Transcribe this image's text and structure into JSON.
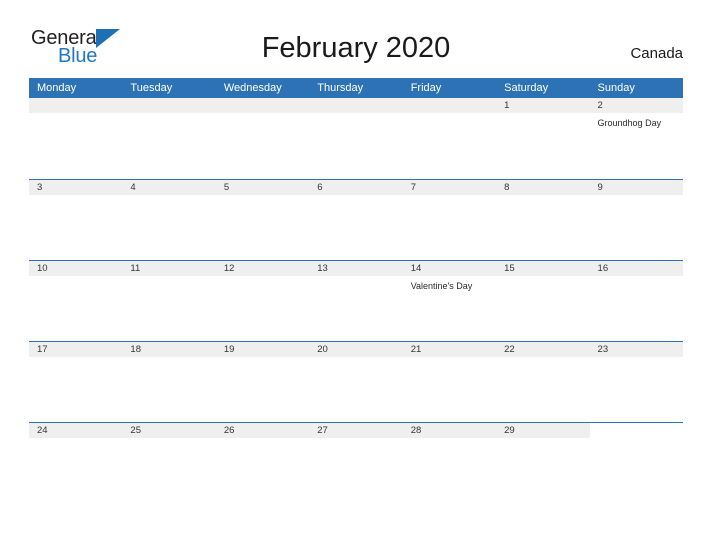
{
  "brand": {
    "word_one": "General",
    "word_two": "Blue",
    "triangle_color": "#1f6fb5",
    "word_two_color": "#1f78c1"
  },
  "header": {
    "title": "February 2020",
    "country": "Canada"
  },
  "theme": {
    "header_blue": "#2d72b5",
    "date_band_gray": "#efefef",
    "page_background": "#ffffff"
  },
  "calendar": {
    "weekday_headers": [
      "Monday",
      "Tuesday",
      "Wednesday",
      "Thursday",
      "Friday",
      "Saturday",
      "Sunday"
    ],
    "weeks": [
      [
        {
          "day": "",
          "event": "",
          "filled": false
        },
        {
          "day": "",
          "event": "",
          "filled": false
        },
        {
          "day": "",
          "event": "",
          "filled": false
        },
        {
          "day": "",
          "event": "",
          "filled": false
        },
        {
          "day": "",
          "event": "",
          "filled": false
        },
        {
          "day": "1",
          "event": "",
          "filled": true
        },
        {
          "day": "2",
          "event": "Groundhog Day",
          "filled": true
        }
      ],
      [
        {
          "day": "3",
          "event": "",
          "filled": true
        },
        {
          "day": "4",
          "event": "",
          "filled": true
        },
        {
          "day": "5",
          "event": "",
          "filled": true
        },
        {
          "day": "6",
          "event": "",
          "filled": true
        },
        {
          "day": "7",
          "event": "",
          "filled": true
        },
        {
          "day": "8",
          "event": "",
          "filled": true
        },
        {
          "day": "9",
          "event": "",
          "filled": true
        }
      ],
      [
        {
          "day": "10",
          "event": "",
          "filled": true
        },
        {
          "day": "11",
          "event": "",
          "filled": true
        },
        {
          "day": "12",
          "event": "",
          "filled": true
        },
        {
          "day": "13",
          "event": "",
          "filled": true
        },
        {
          "day": "14",
          "event": "Valentine's Day",
          "filled": true
        },
        {
          "day": "15",
          "event": "",
          "filled": true
        },
        {
          "day": "16",
          "event": "",
          "filled": true
        }
      ],
      [
        {
          "day": "17",
          "event": "",
          "filled": true
        },
        {
          "day": "18",
          "event": "",
          "filled": true
        },
        {
          "day": "19",
          "event": "",
          "filled": true
        },
        {
          "day": "20",
          "event": "",
          "filled": true
        },
        {
          "day": "21",
          "event": "",
          "filled": true
        },
        {
          "day": "22",
          "event": "",
          "filled": true
        },
        {
          "day": "23",
          "event": "",
          "filled": true
        }
      ],
      [
        {
          "day": "24",
          "event": "",
          "filled": true
        },
        {
          "day": "25",
          "event": "",
          "filled": true
        },
        {
          "day": "26",
          "event": "",
          "filled": true
        },
        {
          "day": "27",
          "event": "",
          "filled": true
        },
        {
          "day": "28",
          "event": "",
          "filled": true
        },
        {
          "day": "29",
          "event": "",
          "filled": true
        },
        {
          "day": "",
          "event": "",
          "filled": false
        }
      ]
    ]
  }
}
